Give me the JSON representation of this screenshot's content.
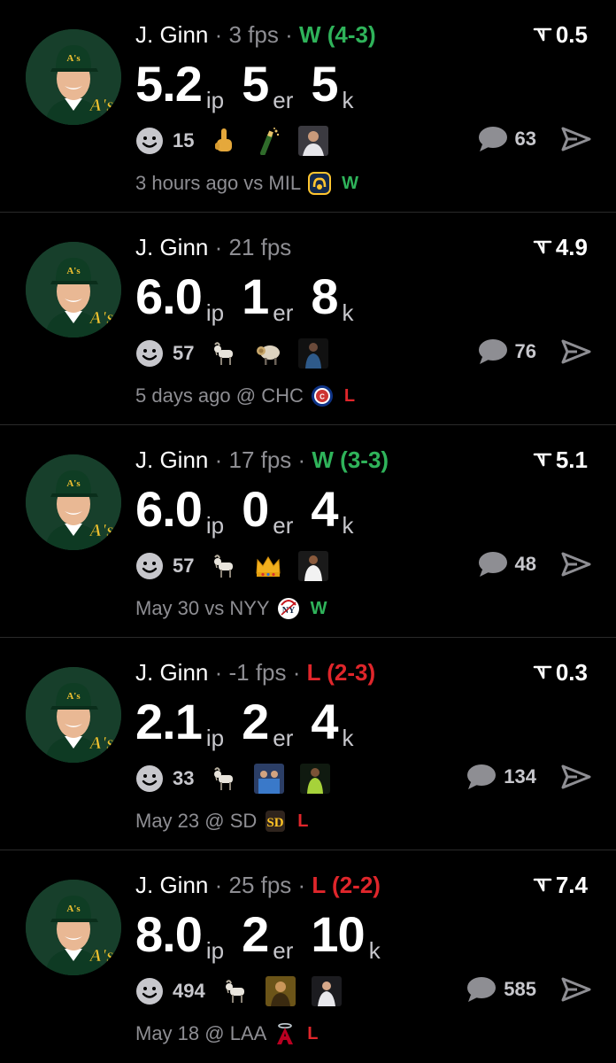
{
  "colors": {
    "background": "#000000",
    "win": "#2fb35a",
    "loss": "#e0262b",
    "muted": "#8e8e93",
    "divider": "#2a2a2a"
  },
  "posts": [
    {
      "player": "J. Ginn",
      "sep1": " · ",
      "fps": "3 fps",
      "sep2": " · ",
      "record": "W (4-3)",
      "score": "0.5",
      "ip": "5.2",
      "ip_label": "ip",
      "er": "5",
      "er_label": "er",
      "k": "5",
      "k_label": "k",
      "reactions": "15",
      "comments": "63",
      "when": "3 hours ago vs MIL",
      "result": "W",
      "opponent_logo": "brewers-logo-icon",
      "emojis": [
        "middle-finger-icon",
        "champagne-icon",
        "reaction-gif-thumbnail"
      ]
    },
    {
      "player": "J. Ginn",
      "sep1": " · ",
      "fps": "21 fps",
      "sep2": "",
      "record": "",
      "score": "4.9",
      "ip": "6.0",
      "ip_label": "ip",
      "er": "1",
      "er_label": "er",
      "k": "8",
      "k_label": "k",
      "reactions": "57",
      "comments": "76",
      "when": "5 days ago @ CHC",
      "result": "L",
      "opponent_logo": "cubs-logo-icon",
      "emojis": [
        "goat-icon",
        "ram-icon",
        "reaction-gif-thumbnail"
      ]
    },
    {
      "player": "J. Ginn",
      "sep1": " · ",
      "fps": "17 fps",
      "sep2": " · ",
      "record": "W (3-3)",
      "score": "5.1",
      "ip": "6.0",
      "ip_label": "ip",
      "er": "0",
      "er_label": "er",
      "k": "4",
      "k_label": "k",
      "reactions": "57",
      "comments": "48",
      "when": "May 30 vs NYY",
      "result": "W",
      "opponent_logo": "yankees-logo-icon",
      "emojis": [
        "goat-icon",
        "crown-icon",
        "reaction-gif-thumbnail"
      ]
    },
    {
      "player": "J. Ginn",
      "sep1": " · ",
      "fps": "-1 fps",
      "sep2": " · ",
      "record": "L (2-3)",
      "score": "0.3",
      "ip": "2.1",
      "ip_label": "ip",
      "er": "2",
      "er_label": "er",
      "k": "4",
      "k_label": "k",
      "reactions": "33",
      "comments": "134",
      "when": "May 23 @ SD",
      "result": "L",
      "opponent_logo": "padres-logo-icon",
      "emojis": [
        "goat-icon",
        "reaction-gif-thumbnail",
        "reaction-gif-thumbnail"
      ]
    },
    {
      "player": "J. Ginn",
      "sep1": " · ",
      "fps": "25 fps",
      "sep2": " · ",
      "record": "L (2-2)",
      "score": "7.4",
      "ip": "8.0",
      "ip_label": "ip",
      "er": "2",
      "er_label": "er",
      "k": "10",
      "k_label": "k",
      "reactions": "494",
      "comments": "585",
      "when": "May 18 @ LAA",
      "result": "L",
      "opponent_logo": "angels-logo-icon",
      "emojis": [
        "goat-icon",
        "reaction-gif-thumbnail",
        "reaction-gif-thumbnail"
      ]
    }
  ]
}
